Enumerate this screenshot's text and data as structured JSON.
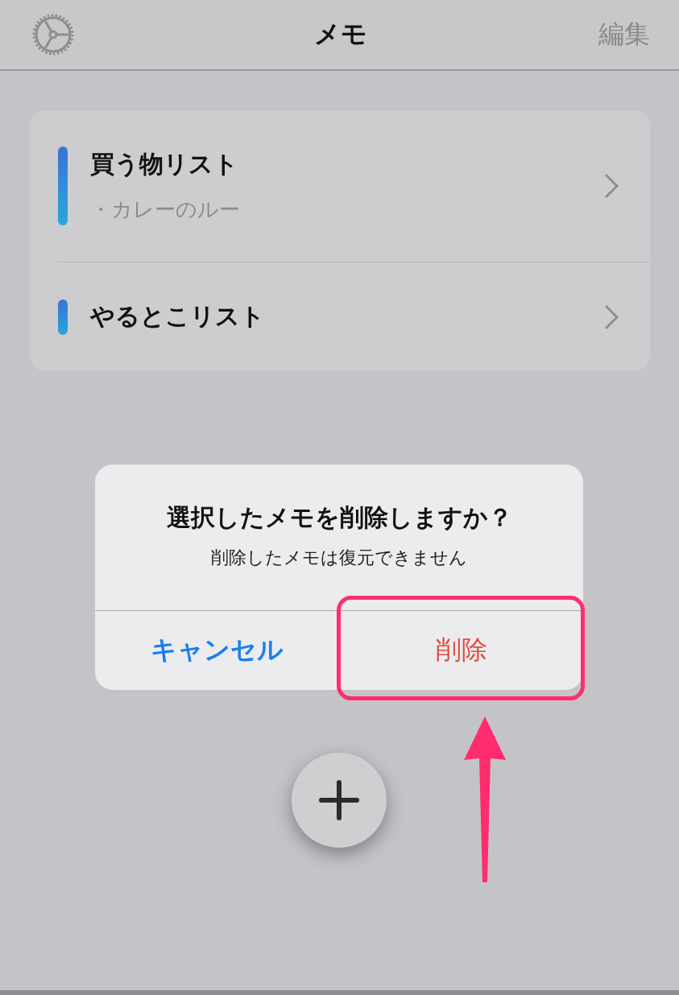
{
  "nav": {
    "title": "メモ",
    "edit_label": "編集"
  },
  "memos": [
    {
      "title": "買う物リスト",
      "preview": "・カレーのルー"
    },
    {
      "title": "やるとこリスト"
    }
  ],
  "alert": {
    "title": "選択したメモを削除しますか？",
    "message": "削除したメモは復元できません",
    "buttons": [
      {
        "label": "キャンセル",
        "kind": "cancel"
      },
      {
        "label": "削除",
        "kind": "destructive"
      }
    ]
  }
}
